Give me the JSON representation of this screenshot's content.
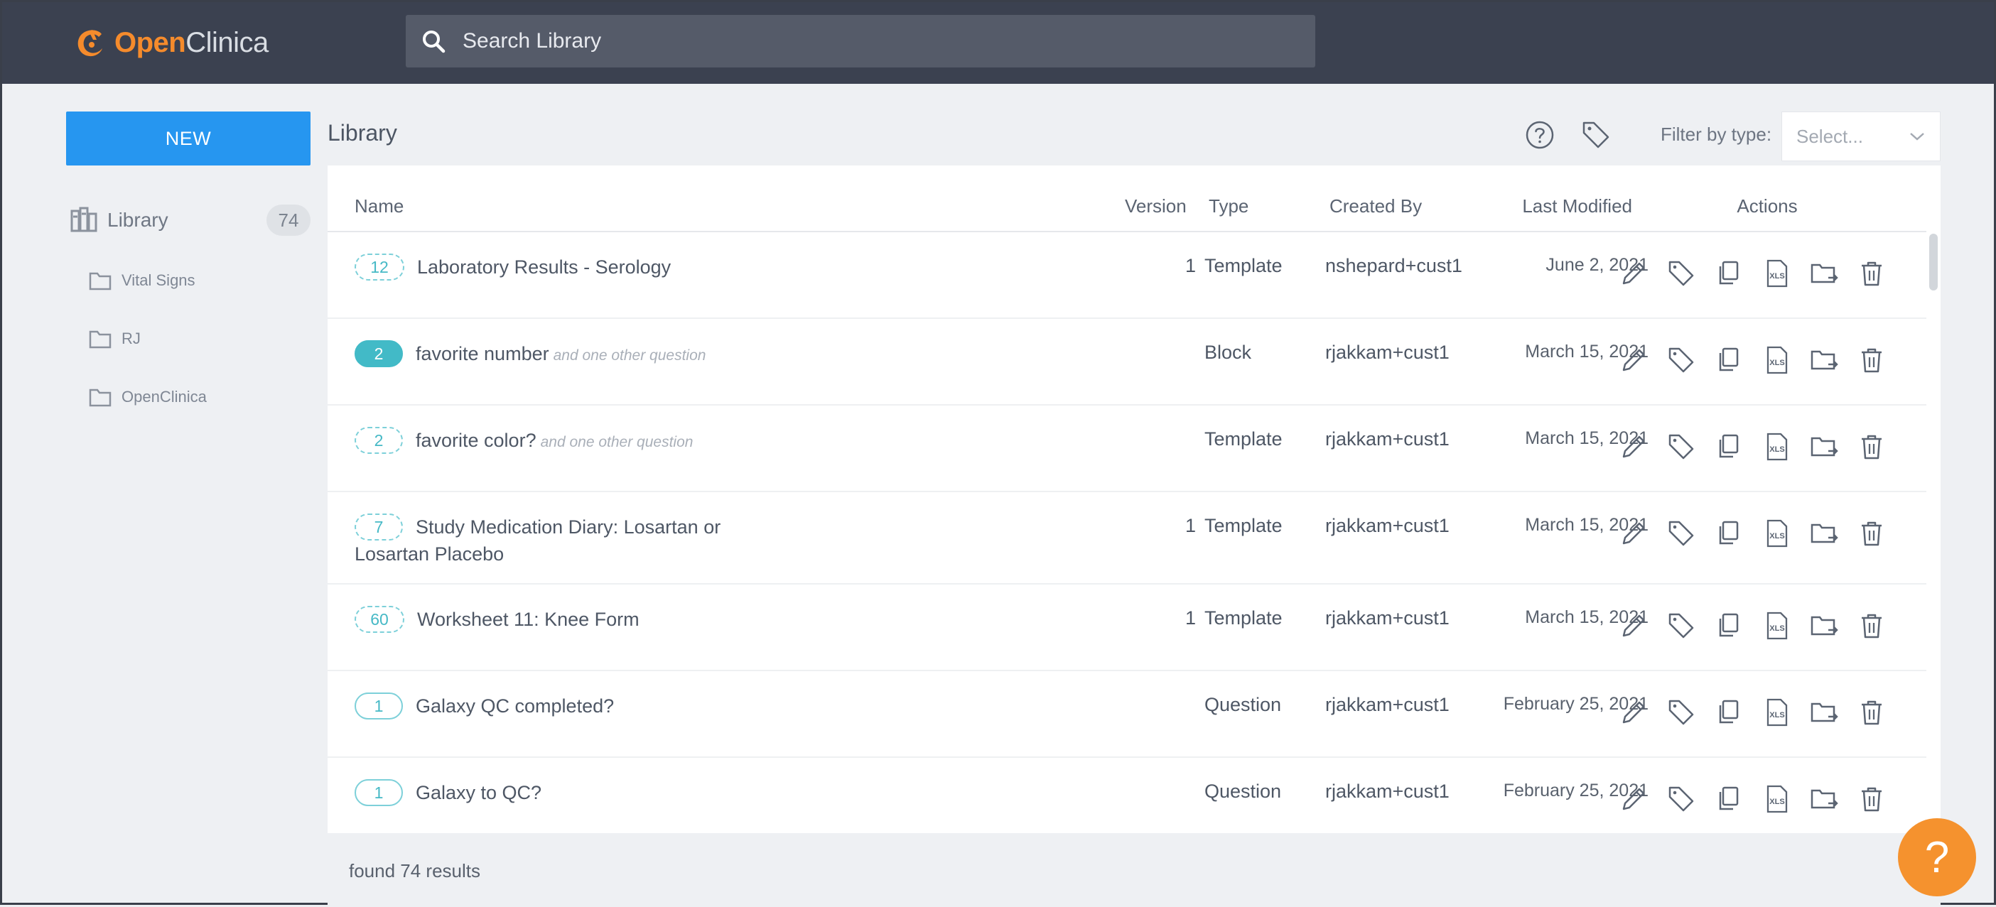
{
  "app": {
    "logo_open": "Open",
    "logo_clinica": "Clinica"
  },
  "search": {
    "placeholder": "Search Library"
  },
  "sidebar": {
    "new_label": "NEW",
    "library_label": "Library",
    "library_count": "74",
    "folders": [
      "Vital Signs",
      "RJ",
      "OpenClinica"
    ]
  },
  "main": {
    "title": "Library",
    "filter_label": "Filter by type:",
    "filter_placeholder": "Select..."
  },
  "table": {
    "headers": {
      "name": "Name",
      "version": "Version",
      "type": "Type",
      "created_by": "Created By",
      "last_modified": "Last Modified",
      "actions": "Actions"
    },
    "rows": [
      {
        "badge": "12",
        "name": "Laboratory Results - Serology",
        "sub": "",
        "version": "1",
        "type": "Template",
        "created_by": "nshepard+cust1",
        "modified": "June 2, 2021"
      },
      {
        "badge": "2",
        "name": "favorite number",
        "sub": "and one other question",
        "version": "",
        "type": "Block",
        "created_by": "rjakkam+cust1",
        "modified": "March 15, 2021"
      },
      {
        "badge": "2",
        "name": "favorite color?",
        "sub": "and one other question",
        "version": "",
        "type": "Template",
        "created_by": "rjakkam+cust1",
        "modified": "March 15, 2021"
      },
      {
        "badge": "7",
        "name": "Study Medication Diary: Losartan or",
        "name2": "Losartan Placebo",
        "sub": "",
        "version": "1",
        "type": "Template",
        "created_by": "rjakkam+cust1",
        "modified": "March 15, 2021"
      },
      {
        "badge": "60",
        "name": "Worksheet 11: Knee Form",
        "sub": "",
        "version": "1",
        "type": "Template",
        "created_by": "rjakkam+cust1",
        "modified": "March 15, 2021"
      },
      {
        "badge": "1",
        "name": "Galaxy QC completed?",
        "sub": "",
        "version": "",
        "type": "Question",
        "created_by": "rjakkam+cust1",
        "modified": "February 25, 2021"
      },
      {
        "badge": "1",
        "name": "Galaxy to QC?",
        "sub": "",
        "version": "",
        "type": "Question",
        "created_by": "rjakkam+cust1",
        "modified": "February 25, 2021"
      }
    ],
    "footer": "found 74 results"
  },
  "help_fab": "?",
  "icons": {
    "actions": [
      "pencil-icon",
      "tag-icon",
      "copy-icon",
      "xls-icon",
      "move-to-folder-icon",
      "trash-icon"
    ],
    "action_xls_text": "XLS"
  },
  "colors": {
    "topbar": "#3b4150",
    "accent_blue": "#2696f0",
    "brand_orange": "#f58b2c",
    "badge_teal": "#42bac7"
  }
}
